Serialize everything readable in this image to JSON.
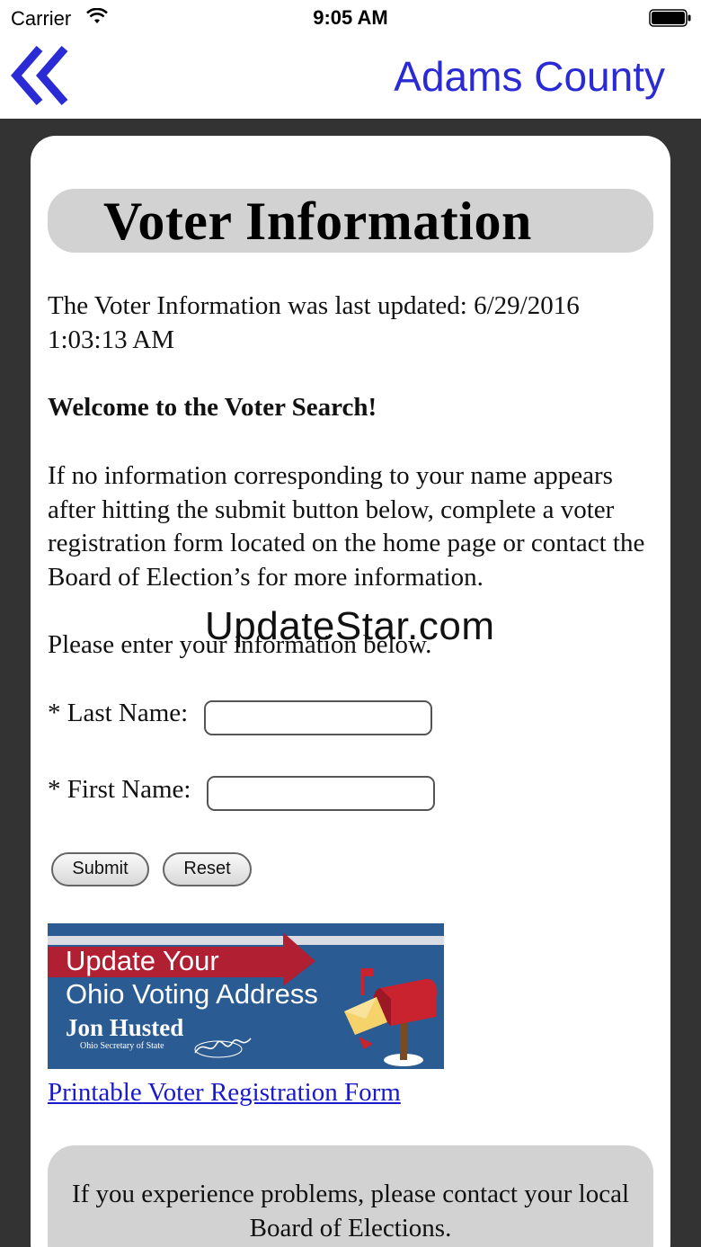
{
  "status_bar": {
    "carrier": "Carrier",
    "time": "9:05 AM"
  },
  "nav": {
    "title": "Adams County",
    "accent_color": "#2b2bd6",
    "back_icon": "double-chevron-left-icon"
  },
  "page": {
    "header": "Voter Information",
    "updated_text": "The Voter Information was last updated: 6/29/2016 1:03:13 AM",
    "welcome": "Welcome to the Voter Search!",
    "info": "If no information corresponding to your name appears after hitting the submit button below, complete a voter registration form located on the home page or contact the Board of Election’s for more information.",
    "please_enter": "Please enter your information below.",
    "form": {
      "last_name_label": "* Last Name:",
      "last_name_value": "",
      "first_name_label": "* First Name:",
      "first_name_value": "",
      "submit_label": "Submit",
      "reset_label": "Reset"
    },
    "banner": {
      "line1": "Update Your",
      "line2": "Ohio Voting Address",
      "name": "Jon Husted",
      "subtitle": "Ohio Secretary of State"
    },
    "registration_link": "Printable Voter Registration Form",
    "footer": "If you experience problems, please contact your local Board of Elections."
  },
  "watermark": "UpdateStar.com"
}
